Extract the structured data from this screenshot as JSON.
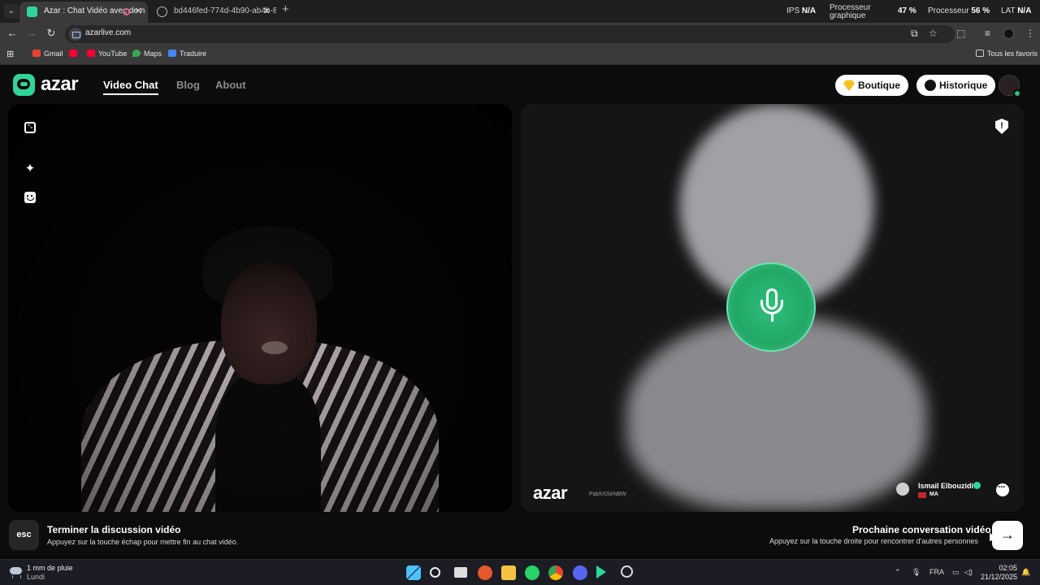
{
  "browser": {
    "tabs": [
      {
        "title": "Azar : Chat Vidéo avec de n"
      },
      {
        "title": "bd446fed-774d-4b90-ab4b-8c"
      }
    ],
    "url": "azarlive.com",
    "bookmarks": [
      "Gmail",
      "YouTube",
      "Maps",
      "Traduire"
    ],
    "all_bookmarks": "Tous les favoris"
  },
  "sysmon": {
    "ips_label": "IPS",
    "ips_value": "N/A",
    "gpu_label_1": "Processeur",
    "gpu_label_2": "graphique",
    "gpu_value": "47 %",
    "cpu_label": "Processeur",
    "cpu_value": "56 %",
    "lat_label": "LAT",
    "lat_value": "N/A"
  },
  "header": {
    "logo": "azar",
    "nav": [
      "Video Chat",
      "Blog",
      "About"
    ],
    "boutique": "Boutique",
    "historique": "Historique"
  },
  "peer": {
    "watermark": "azar",
    "watermark_id": "PabhXSeNBW",
    "name": "Ismail Elbouzidi",
    "country": "MA"
  },
  "controls": {
    "esc_key": "esc",
    "end_title": "Terminer la discussion vidéo",
    "end_sub": "Appuyez sur la touche échap pour mettre fin au chat vidéo.",
    "next_title": "Prochaine conversation vidéo",
    "next_sub": "Appuyez sur la touche droite pour rencontrer d'autres personnes",
    "next_arrow": "→"
  },
  "taskbar": {
    "weather_line1": "1 mm de pluie",
    "weather_line2": "Lundi",
    "lang": "FRA",
    "time": "02:05",
    "date": "21/12/2025"
  },
  "colors": {
    "brand_green": "#2ed69a",
    "mic_green": "#22a866",
    "boutique_gem": "#f4c11f"
  }
}
